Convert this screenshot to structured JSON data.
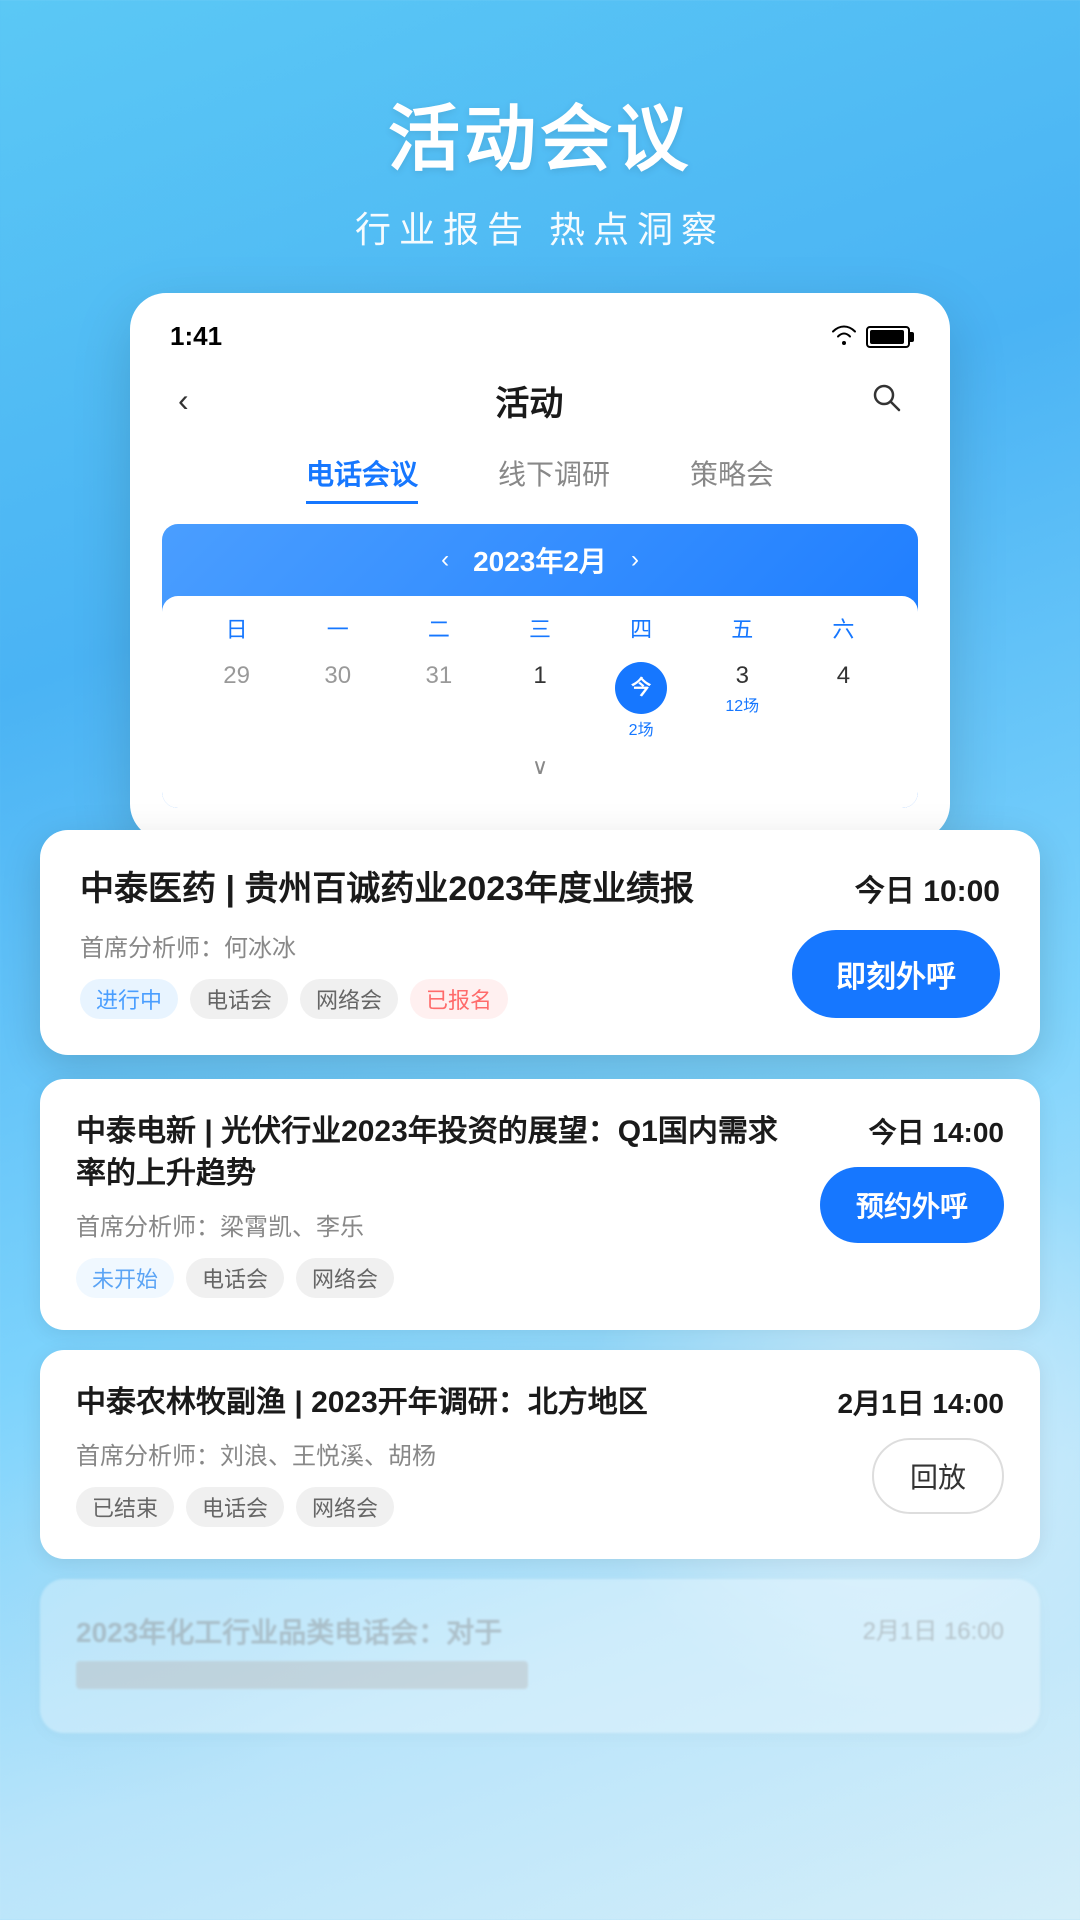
{
  "page": {
    "title": "活动会议",
    "subtitle": "行业报告  热点洞察"
  },
  "statusBar": {
    "time": "1:41",
    "wifi": "📶",
    "battery": "battery"
  },
  "appBar": {
    "back": "‹",
    "title": "活动",
    "search": "🔍"
  },
  "tabs": [
    {
      "label": "电话会议",
      "active": true
    },
    {
      "label": "线下调研",
      "active": false
    },
    {
      "label": "策略会",
      "active": false
    }
  ],
  "calendar": {
    "month": "2023年2月",
    "weekdays": [
      "日",
      "一",
      "二",
      "三",
      "四",
      "五",
      "六"
    ],
    "prevWeekDays": [
      {
        "num": "29",
        "currentMonth": false,
        "sub": ""
      },
      {
        "num": "30",
        "currentMonth": false,
        "sub": ""
      },
      {
        "num": "31",
        "currentMonth": false,
        "sub": ""
      },
      {
        "num": "1",
        "currentMonth": true,
        "sub": ""
      },
      {
        "num": "今",
        "isToday": true,
        "sub": "2场"
      },
      {
        "num": "3",
        "currentMonth": true,
        "sub": "12场"
      },
      {
        "num": "4",
        "currentMonth": true,
        "sub": ""
      }
    ]
  },
  "featuredEvent": {
    "title": "中泰医药 | 贵州百诚药业2023年度业绩报",
    "analyst": "首席分析师：何冰冰",
    "tags": [
      {
        "label": "进行中",
        "style": "blue-light"
      },
      {
        "label": "电话会",
        "style": "gray-light"
      },
      {
        "label": "网络会",
        "style": "gray-light"
      },
      {
        "label": "已报名",
        "style": "pink-light"
      }
    ],
    "time": "今日 10:00",
    "actionLabel": "即刻外呼"
  },
  "events": [
    {
      "title": "中泰电新 | 光伏行业2023年投资的展望：Q1国内需求率的上升趋势",
      "analyst": "首席分析师：梁霄凯、李乐",
      "tags": [
        {
          "label": "未开始",
          "style": "green-light"
        },
        {
          "label": "电话会",
          "style": "gray-light"
        },
        {
          "label": "网络会",
          "style": "gray-light"
        }
      ],
      "time": "今日 14:00",
      "actionLabel": "预约外呼",
      "actionStyle": "primary"
    },
    {
      "title": "中泰农林牧副渔 | 2023开年调研：北方地区",
      "analyst": "首席分析师：刘浪、王悦溪、胡杨",
      "tags": [
        {
          "label": "已结束",
          "style": "gray-light"
        },
        {
          "label": "电话会",
          "style": "gray-light"
        },
        {
          "label": "网络会",
          "style": "gray-light"
        }
      ],
      "time": "2月1日 14:00",
      "actionLabel": "回放",
      "actionStyle": "outlined"
    }
  ],
  "ghostEvent": {
    "title": "2023年化工行业品类电话会：对于",
    "time": "2月1日 16:00"
  }
}
